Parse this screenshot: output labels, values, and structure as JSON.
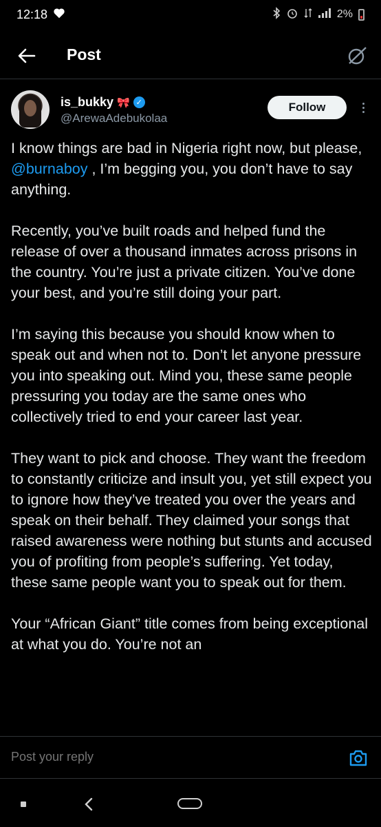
{
  "status_bar": {
    "time": "12:18",
    "battery": "2%"
  },
  "header": {
    "title": "Post"
  },
  "author": {
    "name": "is_bukky",
    "handle": "@ArewaAdebukolaa",
    "follow_label": "Follow"
  },
  "post": {
    "paragraphs": [
      {
        "before": "I know things are bad in Nigeria right now, but please, ",
        "mention": "@burnaboy",
        "after": " , I’m begging you, you don’t have to say anything."
      },
      {
        "text": "Recently, you’ve built roads and helped fund the release of over a thousand inmates across prisons in the country. You’re just a private citizen. You’ve done your best, and you’re still doing your part."
      },
      {
        "text": "I’m saying this because you should know when to speak out and when not to. Don’t let anyone pressure you into speaking out. Mind you, these same people pressuring you today are the same ones who collectively tried to end your career last year."
      },
      {
        "text": "They want to pick and choose. They want the freedom to constantly criticize and insult you, yet still expect you to ignore how they’ve treated you over the years and speak on their behalf. They claimed your songs that raised awareness were nothing but stunts and accused you of profiting from people’s suffering. Yet today, these same people want you to speak out for them."
      },
      {
        "text": "Your “African Giant” title comes from being exceptional at what you do. You’re not an"
      }
    ]
  },
  "reply": {
    "placeholder": "Post your reply"
  },
  "colors": {
    "background": "#000000",
    "text": "#e7e9ea",
    "secondary_text": "#8b98a5",
    "accent": "#1d9bf0",
    "follow_bg": "#eff3f4"
  }
}
